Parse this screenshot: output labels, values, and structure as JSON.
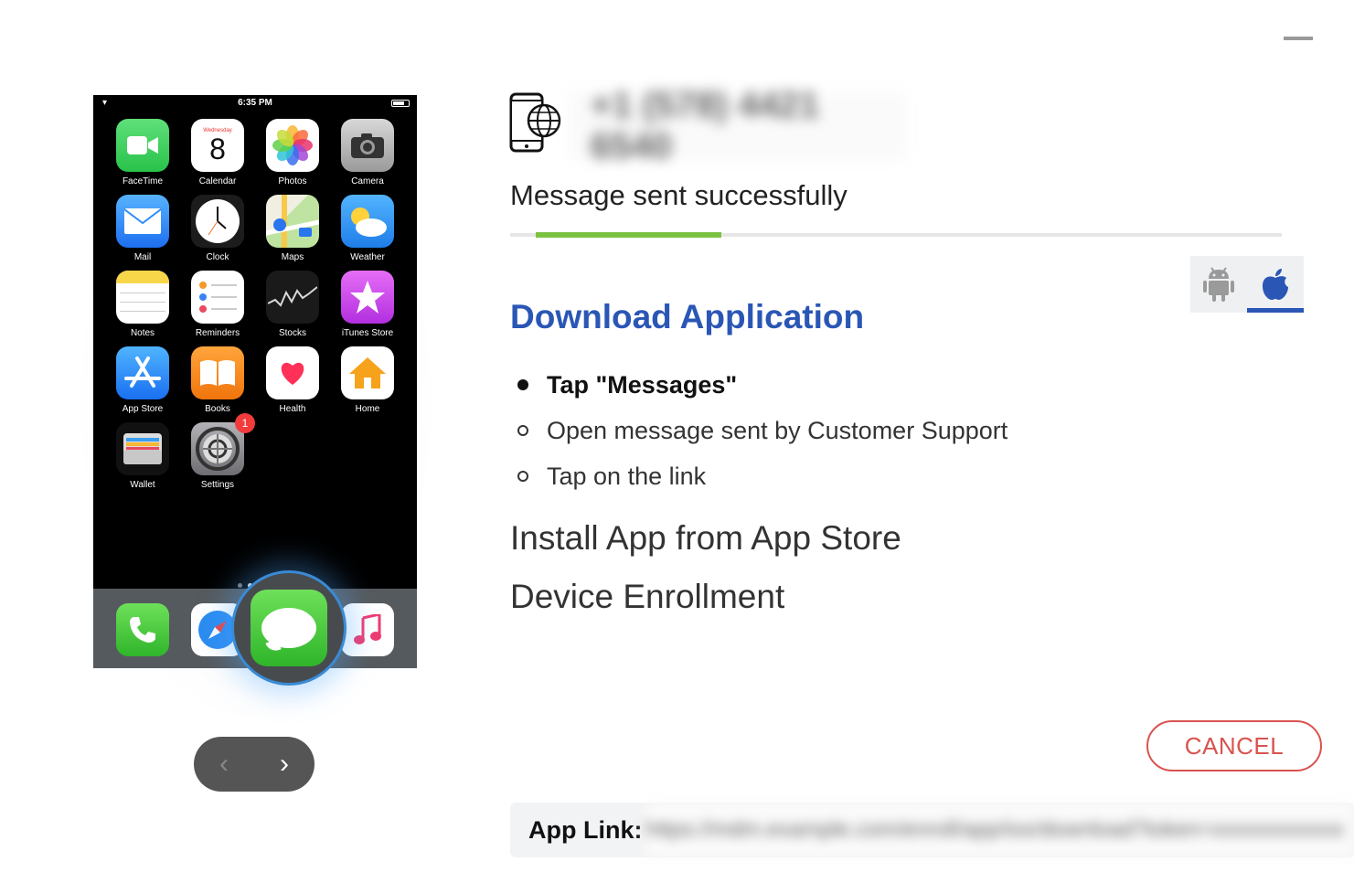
{
  "window": {
    "minimize_icon": "minimize-icon"
  },
  "phone": {
    "status_time": "6:35 PM",
    "wifi_glyph": "◆",
    "apps": [
      {
        "label": "FaceTime",
        "icon": "facetime-icon",
        "color": "#3ad357"
      },
      {
        "label": "Calendar",
        "icon": "calendar-icon",
        "color": "#ffffff",
        "day": "8",
        "weekday": "Wednesday"
      },
      {
        "label": "Photos",
        "icon": "photos-icon",
        "color": "#ffffff"
      },
      {
        "label": "Camera",
        "icon": "camera-icon",
        "color": "#b5b5b5"
      },
      {
        "label": "Mail",
        "icon": "mail-icon",
        "color": "#2f8df5"
      },
      {
        "label": "Clock",
        "icon": "clock-icon",
        "color": "#1c1c1c"
      },
      {
        "label": "Maps",
        "icon": "maps-icon",
        "color": "#e6e4d8"
      },
      {
        "label": "Weather",
        "icon": "weather-icon",
        "color": "#3c9ff0"
      },
      {
        "label": "Notes",
        "icon": "notes-icon",
        "color": "#ffffff"
      },
      {
        "label": "Reminders",
        "icon": "reminders-icon",
        "color": "#ffffff"
      },
      {
        "label": "Stocks",
        "icon": "stocks-icon",
        "color": "#1a1a1a"
      },
      {
        "label": "iTunes Store",
        "icon": "itunes-store-icon",
        "color": "#d24af0"
      },
      {
        "label": "App Store",
        "icon": "app-store-icon",
        "color": "#2a95f4"
      },
      {
        "label": "Books",
        "icon": "books-icon",
        "color": "#f88a1a"
      },
      {
        "label": "Health",
        "icon": "health-icon",
        "color": "#ffffff"
      },
      {
        "label": "Home",
        "icon": "home-icon",
        "color": "#ffffff"
      },
      {
        "label": "Wallet",
        "icon": "wallet-icon",
        "color": "#111111"
      },
      {
        "label": "Settings",
        "icon": "settings-icon",
        "color": "#8e8e93",
        "badge": "1"
      }
    ],
    "dock": [
      "phone-icon",
      "safari-icon",
      "messages-icon",
      "music-icon"
    ]
  },
  "carousel": {
    "prev": "‹",
    "next": "›"
  },
  "device": {
    "phone_number": "+1 (578) 4421 6540"
  },
  "status": {
    "message": "Message sent successfully",
    "progress": 0.24
  },
  "os_toggle": {
    "options": [
      "android-icon",
      "apple-icon"
    ],
    "selected": "apple"
  },
  "download": {
    "title": "Download Application",
    "steps": [
      {
        "text": "Tap \"Messages\"",
        "state": "done"
      },
      {
        "text": "Open message sent by Customer Support",
        "state": "pending"
      },
      {
        "text": "Tap on the link",
        "state": "pending"
      }
    ]
  },
  "sections": {
    "install": "Install App from App Store",
    "enroll": "Device Enrollment"
  },
  "actions": {
    "cancel": "CANCEL"
  },
  "app_link": {
    "label": "App Link:",
    "url": "https://mdm.example.com/enroll/app/ios/download?token=xxxxxxxxxxxx"
  },
  "colors": {
    "accent_blue": "#2a56b5",
    "progress_green": "#7cc242",
    "cancel_red": "#d9534f"
  }
}
